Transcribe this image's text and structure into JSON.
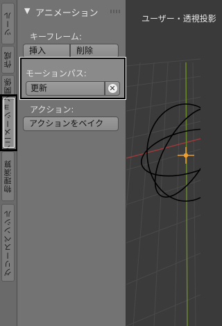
{
  "tabs": [
    {
      "label": "ツール"
    },
    {
      "label": "作成"
    },
    {
      "label": "関係"
    },
    {
      "label": "アニメーション"
    },
    {
      "label": "物理演算"
    },
    {
      "label": "グリースペンシル"
    }
  ],
  "panel": {
    "title": "アニメーション",
    "keyframes_label": "キーフレーム:",
    "insert_label": "挿入",
    "delete_label": "削除",
    "motion_path_label": "モーションパス:",
    "update_label": "更新",
    "action_label": "アクション:",
    "bake_label": "アクションをベイク"
  },
  "viewport": {
    "title": "ユーザー・透視投影"
  },
  "colors": {
    "grid": "#4a4a4a",
    "x_axis": "#9b3a3a",
    "y_axis": "#6b8a2a",
    "origin": "#f0a030"
  }
}
